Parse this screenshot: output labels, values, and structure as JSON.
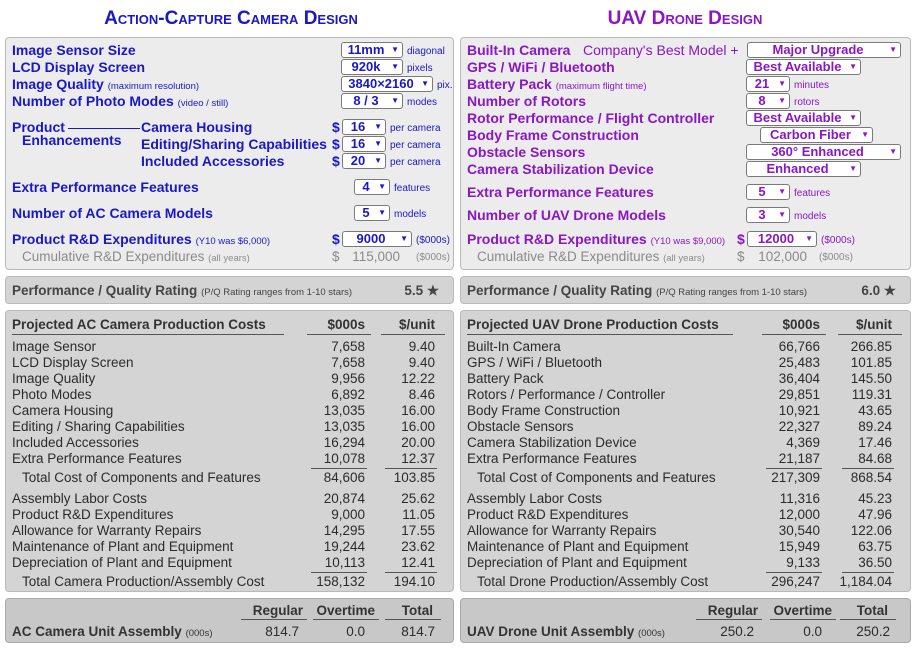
{
  "camera": {
    "title": "Action-Capture Camera Design",
    "specs": [
      {
        "label": "Image Sensor Size",
        "note": "",
        "value": "11mm",
        "unit": "diagonal"
      },
      {
        "label": "LCD Display Screen",
        "note": "",
        "value": "920k",
        "unit": "pixels"
      },
      {
        "label": "Image Quality",
        "note": "(maximum resolution)",
        "value": "3840×2160",
        "unit": "pix."
      },
      {
        "label": "Number of Photo Modes",
        "note": "(video / still)",
        "value": "8 / 3",
        "unit": "modes"
      }
    ],
    "enhancements": {
      "label_line1": "Product",
      "label_line2": "Enhancements",
      "items": [
        {
          "label": "Camera Housing",
          "currency": "$",
          "value": "16",
          "unit": "per camera"
        },
        {
          "label": "Editing/Sharing Capabilities",
          "currency": "$",
          "value": "16",
          "unit": "per camera"
        },
        {
          "label": "Included Accessories",
          "currency": "$",
          "value": "20",
          "unit": "per camera"
        }
      ]
    },
    "extra_features": {
      "label": "Extra Performance Features",
      "value": "4",
      "unit": "features"
    },
    "models": {
      "label": "Number of AC Camera Models",
      "value": "5",
      "unit": "models"
    },
    "rd": {
      "label": "Product R&D Expenditures",
      "note": "(Y10 was $6,000)",
      "currency": "$",
      "value": "9000",
      "unit": "($000s)"
    },
    "cumulative": {
      "label": "Cumulative R&D Expenditures",
      "note": "(all years)",
      "currency": "$",
      "value": "115,000",
      "unit": "($000s)"
    },
    "rating": {
      "label": "Performance / Quality Rating",
      "note": "(P/Q Rating ranges from 1-10 stars)",
      "value": "5.5",
      "star": "★"
    },
    "costs": {
      "title": "Projected AC Camera Production Costs",
      "col1": "$000s",
      "col2": "$/unit",
      "components": [
        {
          "name": "Image Sensor",
          "total": "7,658",
          "unit": "9.40"
        },
        {
          "name": "LCD Display Screen",
          "total": "7,658",
          "unit": "9.40"
        },
        {
          "name": "Image Quality",
          "total": "9,956",
          "unit": "12.22"
        },
        {
          "name": "Photo Modes",
          "total": "6,892",
          "unit": "8.46"
        },
        {
          "name": "Camera Housing",
          "total": "13,035",
          "unit": "16.00"
        },
        {
          "name": "Editing / Sharing Capabilities",
          "total": "13,035",
          "unit": "16.00"
        },
        {
          "name": "Included Accessories",
          "total": "16,294",
          "unit": "20.00"
        },
        {
          "name": "Extra Performance Features",
          "total": "10,078",
          "unit": "12.37"
        }
      ],
      "components_total": {
        "name": "Total Cost of Components and Features",
        "total": "84,606",
        "unit": "103.85"
      },
      "other": [
        {
          "name": "Assembly Labor Costs",
          "total": "20,874",
          "unit": "25.62"
        },
        {
          "name": "Product R&D Expenditures",
          "total": "9,000",
          "unit": "11.05"
        },
        {
          "name": "Allowance for Warranty Repairs",
          "total": "14,295",
          "unit": "17.55"
        },
        {
          "name": "Maintenance of Plant and Equipment",
          "total": "19,244",
          "unit": "23.62"
        },
        {
          "name": "Depreciation of Plant and Equipment",
          "total": "10,113",
          "unit": "12.41"
        }
      ],
      "grand_total": {
        "name": "Total Camera Production/Assembly Cost",
        "total": "158,132",
        "unit": "194.10"
      }
    },
    "assembly": {
      "label": "AC Camera Unit Assembly",
      "note": "(000s)",
      "h_regular": "Regular",
      "h_overtime": "Overtime",
      "h_total": "Total",
      "regular": "814.7",
      "overtime": "0.0",
      "total": "814.7"
    }
  },
  "drone": {
    "title": "UAV Drone Design",
    "camera": {
      "label": "Built-In Camera",
      "extra": "Company's Best Model +",
      "value": "Major Upgrade"
    },
    "specs": [
      {
        "label": "GPS / WiFi / Bluetooth",
        "note": "",
        "value": "Best Available",
        "unit": ""
      },
      {
        "label": "Battery Pack",
        "note": "(maximum flight time)",
        "value": "21",
        "unit": "minutes"
      },
      {
        "label": "Number of Rotors",
        "note": "",
        "value": "8",
        "unit": "rotors"
      },
      {
        "label": "Rotor Performance / Flight Controller",
        "note": "",
        "value": "Best Available",
        "unit": ""
      },
      {
        "label": "Body Frame Construction",
        "note": "",
        "value": "Carbon Fiber",
        "unit": ""
      },
      {
        "label": "Obstacle Sensors",
        "note": "",
        "value": "360° Enhanced",
        "unit": ""
      },
      {
        "label": "Camera Stabilization Device",
        "note": "",
        "value": "Enhanced",
        "unit": ""
      }
    ],
    "extra_features": {
      "label": "Extra Performance Features",
      "value": "5",
      "unit": "features"
    },
    "models": {
      "label": "Number of UAV Drone Models",
      "value": "3",
      "unit": "models"
    },
    "rd": {
      "label": "Product R&D Expenditures",
      "note": "(Y10 was $9,000)",
      "currency": "$",
      "value": "12000",
      "unit": "($000s)"
    },
    "cumulative": {
      "label": "Cumulative R&D Expenditures",
      "note": "(all years)",
      "currency": "$",
      "value": "102,000",
      "unit": "($000s)"
    },
    "rating": {
      "label": "Performance / Quality Rating",
      "note": "(P/Q Rating ranges from 1-10 stars)",
      "value": "6.0",
      "star": "★"
    },
    "costs": {
      "title": "Projected UAV Drone Production Costs",
      "col1": "$000s",
      "col2": "$/unit",
      "components": [
        {
          "name": "Built-In Camera",
          "total": "66,766",
          "unit": "266.85"
        },
        {
          "name": "GPS / WiFi / Bluetooth",
          "total": "25,483",
          "unit": "101.85"
        },
        {
          "name": "Battery Pack",
          "total": "36,404",
          "unit": "145.50"
        },
        {
          "name": "Rotors / Performance / Controller",
          "total": "29,851",
          "unit": "119.31"
        },
        {
          "name": "Body Frame Construction",
          "total": "10,921",
          "unit": "43.65"
        },
        {
          "name": "Obstacle Sensors",
          "total": "22,327",
          "unit": "89.24"
        },
        {
          "name": "Camera Stabilization Device",
          "total": "4,369",
          "unit": "17.46"
        },
        {
          "name": "Extra Performance Features",
          "total": "21,187",
          "unit": "84.68"
        }
      ],
      "components_total": {
        "name": "Total Cost of Components and Features",
        "total": "217,309",
        "unit": "868.54"
      },
      "other": [
        {
          "name": "Assembly Labor Costs",
          "total": "11,316",
          "unit": "45.23"
        },
        {
          "name": "Product R&D Expenditures",
          "total": "12,000",
          "unit": "47.96"
        },
        {
          "name": "Allowance for Warranty Repairs",
          "total": "30,540",
          "unit": "122.06"
        },
        {
          "name": "Maintenance of Plant and Equipment",
          "total": "15,949",
          "unit": "63.75"
        },
        {
          "name": "Depreciation of Plant and Equipment",
          "total": "9,133",
          "unit": "36.50"
        }
      ],
      "grand_total": {
        "name": "Total Drone Production/Assembly Cost",
        "total": "296,247",
        "unit": "1,184.04"
      }
    },
    "assembly": {
      "label": "UAV Drone Unit Assembly",
      "note": "(000s)",
      "h_regular": "Regular",
      "h_overtime": "Overtime",
      "h_total": "Total",
      "regular": "250.2",
      "overtime": "0.0",
      "total": "250.2"
    }
  },
  "caret": "▼",
  "colors": {
    "camera_accent": "#1a17c8",
    "drone_accent": "#8a16c4",
    "panel_light": "#ececec",
    "panel_mid": "#d4d4d4",
    "panel_dark": "#c8c8c8"
  }
}
